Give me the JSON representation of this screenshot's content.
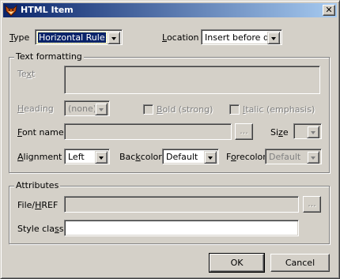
{
  "window": {
    "title": "HTML Item",
    "close_glyph": "✕"
  },
  "type_field": {
    "label_u": "T",
    "label_rest": "ype",
    "value": "Horizontal Rule"
  },
  "location_field": {
    "label_u": "L",
    "label_rest": "ocation",
    "value": "Insert before data"
  },
  "text_formatting": {
    "legend": "Text formatting",
    "text_label_pre": "Te",
    "text_label_u": "x",
    "text_label_post": "t",
    "heading_label_u": "H",
    "heading_label_rest": "eading",
    "heading_value": "(none)",
    "bold_label_u": "B",
    "bold_label_rest": "old (strong)",
    "italic_label_u": "I",
    "italic_label_rest": "talic (emphasis)",
    "font_label_u": "F",
    "font_label_rest": "ont name",
    "font_browse": "...",
    "size_label_pre": "Si",
    "size_label_u": "z",
    "size_label_post": "e",
    "alignment_label_u": "A",
    "alignment_label_rest": "lignment",
    "alignment_value": "Left",
    "backcolor_label_pre": "Bac",
    "backcolor_label_u": "k",
    "backcolor_label_post": "color",
    "backcolor_value": "Default",
    "forecolor_label_pre": "F",
    "forecolor_label_u": "o",
    "forecolor_label_post": "recolor",
    "forecolor_value": "Default"
  },
  "attributes": {
    "legend": "Attributes",
    "file_label_pre": "File/",
    "file_label_u": "H",
    "file_label_post": "REF",
    "file_browse": "...",
    "style_label_pre": "Style cla",
    "style_label_u": "s",
    "style_label_post": "s"
  },
  "buttons": {
    "ok": "OK",
    "cancel": "Cancel"
  },
  "colors": {
    "title_start": "#0a246a",
    "title_end": "#a6caf0",
    "face": "#d4d0c8",
    "selection": "#0a246a"
  },
  "icons": {
    "app": "fox-icon",
    "close": "close-icon"
  }
}
